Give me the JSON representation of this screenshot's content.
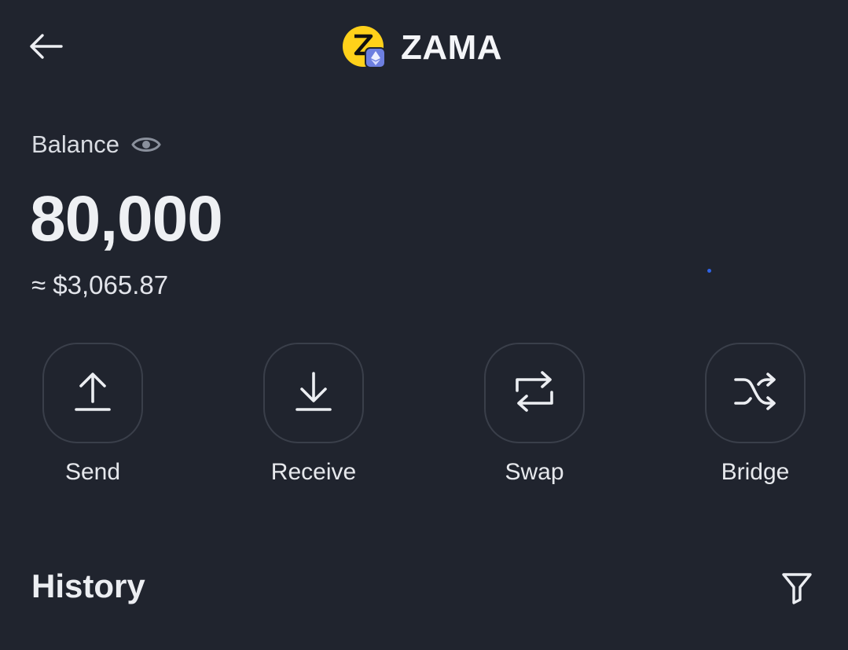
{
  "header": {
    "title": "ZAMA",
    "back_icon": "arrow-left-icon",
    "token_icon": "zama-token-icon",
    "chain_icon": "ethereum-icon"
  },
  "balance": {
    "label": "Balance",
    "visibility_icon": "eye-icon",
    "amount": "80,000",
    "fiat": "≈ $3,065.87"
  },
  "actions": [
    {
      "label": "Send",
      "icon": "upload-icon"
    },
    {
      "label": "Receive",
      "icon": "download-icon"
    },
    {
      "label": "Swap",
      "icon": "swap-icon"
    },
    {
      "label": "Bridge",
      "icon": "shuffle-icon"
    }
  ],
  "history": {
    "title": "History",
    "filter_icon": "filter-icon"
  },
  "colors": {
    "background": "#20242e",
    "token_yellow": "#ffd11a",
    "chain_badge": "#6d7fe0",
    "text": "#eceef2"
  }
}
